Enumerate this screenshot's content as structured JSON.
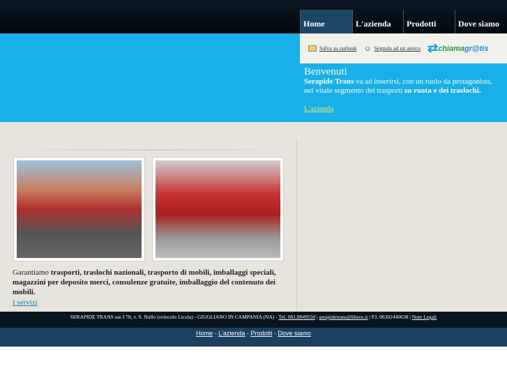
{
  "nav": [
    "Home",
    "L'azienda",
    "Prodotti",
    "Dove siamo"
  ],
  "tools": {
    "outlook": "Salva su outlook",
    "friend": "Segnala ad un amico",
    "logo_text": "chiamagratis"
  },
  "welcome": {
    "title": "Benvenuti",
    "brand": "Serapide Trans",
    "text1": " va ad inserirsi, con un ruolo da protagonista, nel vitale segmento dei trasporti ",
    "bold2": "su ruota e dei traslochi.",
    "link": "L'azienda"
  },
  "description": {
    "lead": "Garantiamo ",
    "bold": "trasporti, traslochi nazionali, trasporto di mobili, imballaggi speciali, magazzini per deposito merci, consulenze gratuite, imballaggio del contenuto dei mobili.",
    "link": "I servizi"
  },
  "footer": {
    "address": "SERAPIDE TRANS sas I 78, v. S. Nullo (svincolo Licola) - GIUGLIANO IN CAMPANIA (NA) - ",
    "tel": "Tel. 081.8049550",
    "sep": " | ",
    "email": "serapidetrans@libero.it",
    "piva": " | P.I. 06302440638 | ",
    "legal": "Note Legali",
    "links": [
      "Home",
      "L'azienda",
      "Prodotti",
      "Dove siamo"
    ],
    "link_sep": " - "
  }
}
